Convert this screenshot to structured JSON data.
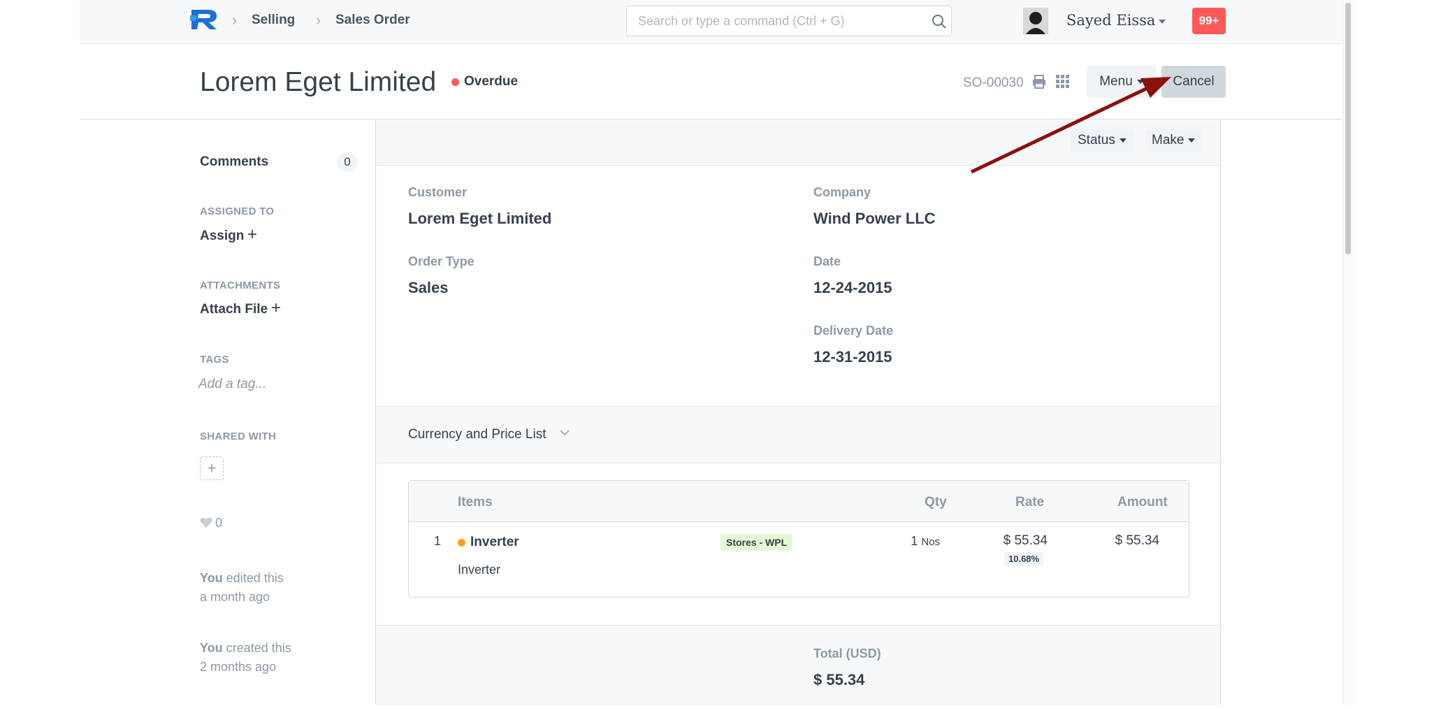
{
  "navbar": {
    "breadcrumbs": [
      "Selling",
      "Sales Order"
    ],
    "search_placeholder": "Search or type a command (Ctrl + G)",
    "user_name": "Sayed Eissa",
    "notification_count": "99+"
  },
  "header": {
    "title": "Lorem Eget Limited",
    "status": "Overdue",
    "status_color": "#ff5858",
    "doc_id": "SO-00030",
    "menu_label": "Menu",
    "cancel_label": "Cancel"
  },
  "sidebar": {
    "comments_label": "Comments",
    "comments_count": "0",
    "assigned_heading": "ASSIGNED TO",
    "assign_label": "Assign",
    "attachments_heading": "ATTACHMENTS",
    "attach_label": "Attach File",
    "tags_heading": "TAGS",
    "tag_placeholder": "Add a tag...",
    "shared_heading": "SHARED WITH",
    "likes": "0",
    "activity": [
      {
        "who": "You",
        "what": " edited this",
        "when": "a month ago"
      },
      {
        "who": "You",
        "what": " created this",
        "when": "2 months ago"
      }
    ]
  },
  "toolbar": {
    "status_label": "Status",
    "make_label": "Make"
  },
  "form": {
    "customer_label": "Customer",
    "customer_value": "Lorem Eget Limited",
    "company_label": "Company",
    "company_value": "Wind Power LLC",
    "order_type_label": "Order Type",
    "order_type_value": "Sales",
    "date_label": "Date",
    "date_value": "12-24-2015",
    "delivery_label": "Delivery Date",
    "delivery_value": "12-31-2015",
    "currency_section": "Currency and Price List",
    "total_label": "Total (USD)",
    "total_value": "$ 55.34"
  },
  "items": {
    "headers": [
      "Items",
      "Qty",
      "Rate",
      "Amount"
    ],
    "rows": [
      {
        "idx": "1",
        "item_code": "Inverter",
        "item_name": "Inverter",
        "warehouse": "Stores - WPL",
        "qty": "1",
        "uom": "Nos",
        "rate": "$ 55.34",
        "discount": "10.68%",
        "amount": "$ 55.34",
        "indicator_color": "#ffa00a"
      }
    ]
  },
  "colors": {
    "brand_blue": "#1c6fd8",
    "arrow": "#8b1010",
    "notification_bg": "#ff5858",
    "warehouse_badge_bg": "#e5f8d3"
  }
}
